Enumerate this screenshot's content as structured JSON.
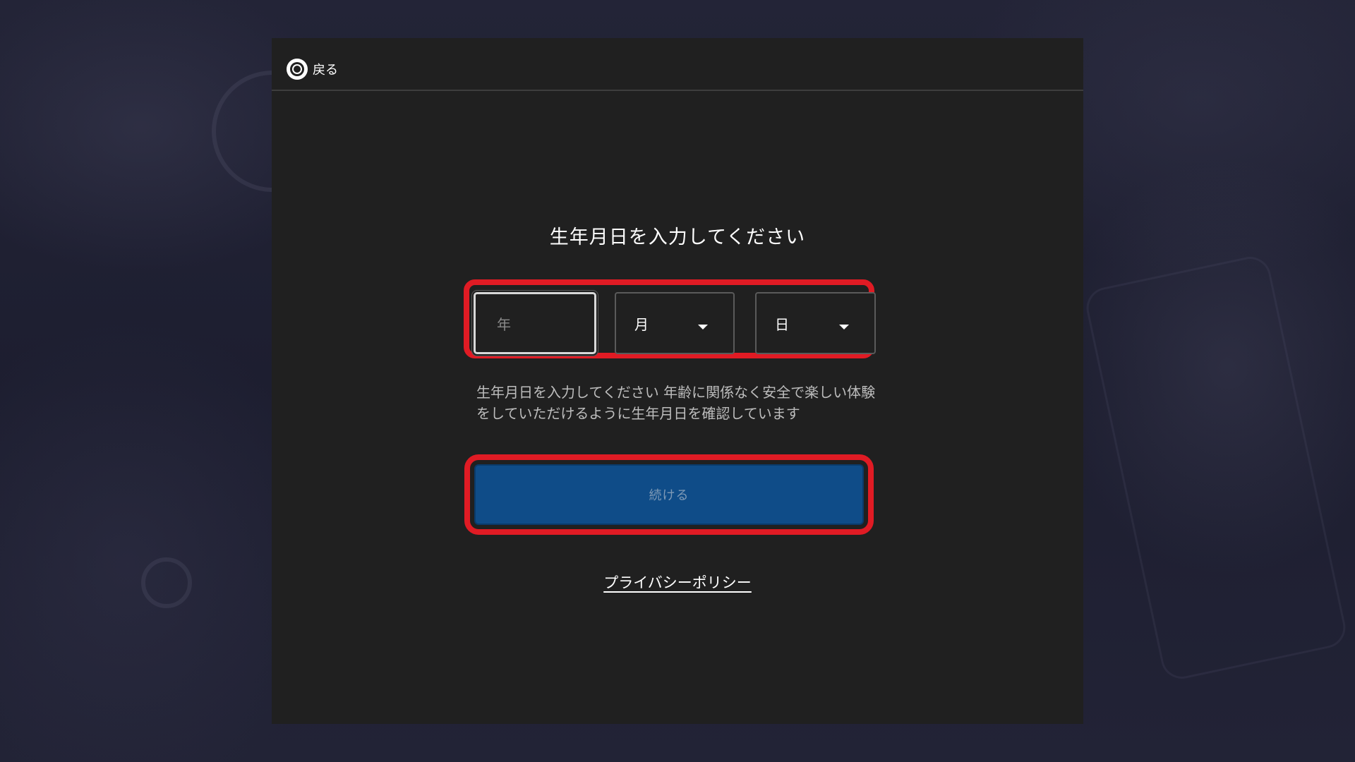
{
  "header": {
    "back_label": "戻る"
  },
  "form": {
    "title": "生年月日を入力してください",
    "year_placeholder": "年",
    "month_label": "月",
    "day_label": "日",
    "description": "生年月日を入力してください 年齢に関係なく安全で楽しい体験をしていただけるように生年月日を確認しています",
    "continue_label": "続ける",
    "privacy_link": "プライバシーポリシー"
  },
  "icons": {
    "back": "circle-button-icon",
    "dropdown": "caret-down-icon"
  },
  "colors": {
    "dialog_bg": "#202020",
    "accent_button": "#0f4c88",
    "highlight": "#e01b24"
  }
}
